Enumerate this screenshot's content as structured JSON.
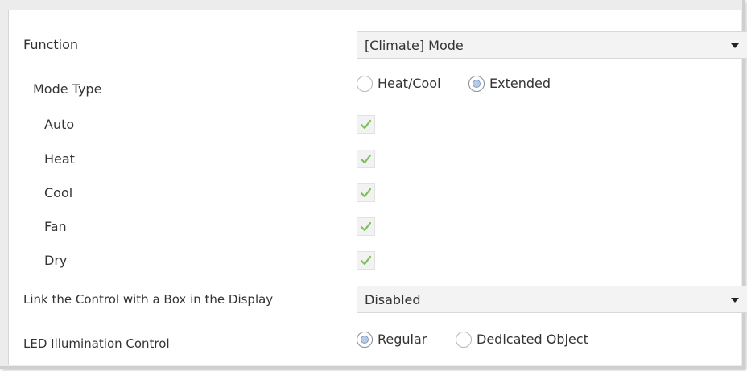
{
  "function": {
    "label": "Function",
    "value": "[Climate] Mode"
  },
  "mode_type": {
    "label": "Mode Type",
    "options": [
      "Heat/Cool",
      "Extended"
    ],
    "selected": "Extended"
  },
  "modes": [
    {
      "label": "Auto",
      "checked": true
    },
    {
      "label": "Heat",
      "checked": true
    },
    {
      "label": "Cool",
      "checked": true
    },
    {
      "label": "Fan",
      "checked": true
    },
    {
      "label": "Dry",
      "checked": true
    }
  ],
  "link_box": {
    "label": "Link the Control with a Box in the Display",
    "value": "Disabled"
  },
  "led": {
    "label": "LED Illumination Control",
    "options": [
      "Regular",
      "Dedicated Object"
    ],
    "selected": "Regular"
  },
  "colors": {
    "check_green": "#7bbf5a",
    "radio_dot": "#b9cbe3"
  },
  "icons": {
    "check": "checkmark-icon",
    "caret": "chevron-down-icon"
  }
}
